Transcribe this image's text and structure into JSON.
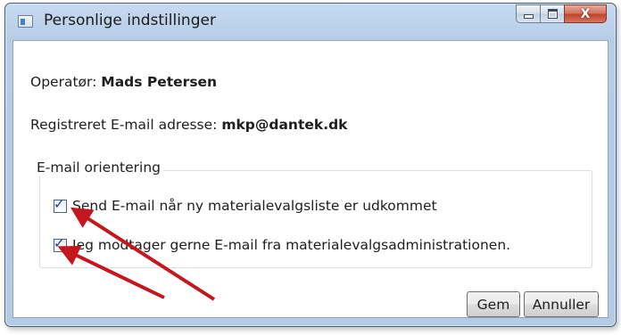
{
  "window": {
    "title": "Personlige indstillinger",
    "close_glyph": "X",
    "icons": {
      "minimize": "minimize-icon",
      "maximize": "maximize-icon",
      "close": "close-icon"
    }
  },
  "operator": {
    "label": "Operatør:",
    "name": "Mads Petersen"
  },
  "email": {
    "label": "Registreret E-mail adresse:",
    "address": "mkp@dantek.dk"
  },
  "notifications": {
    "group_title": "E-mail orientering",
    "options": [
      {
        "label": "Send E-mail når ny materialevalgsliste er udkommet",
        "checked": true
      },
      {
        "label": "Jeg modtager gerne E-mail fra materialevalgsadministrationen.",
        "checked": true
      }
    ]
  },
  "buttons": {
    "save": "Gem",
    "cancel": "Annuller"
  },
  "annotation": {
    "arrow_color": "#c4161c"
  }
}
